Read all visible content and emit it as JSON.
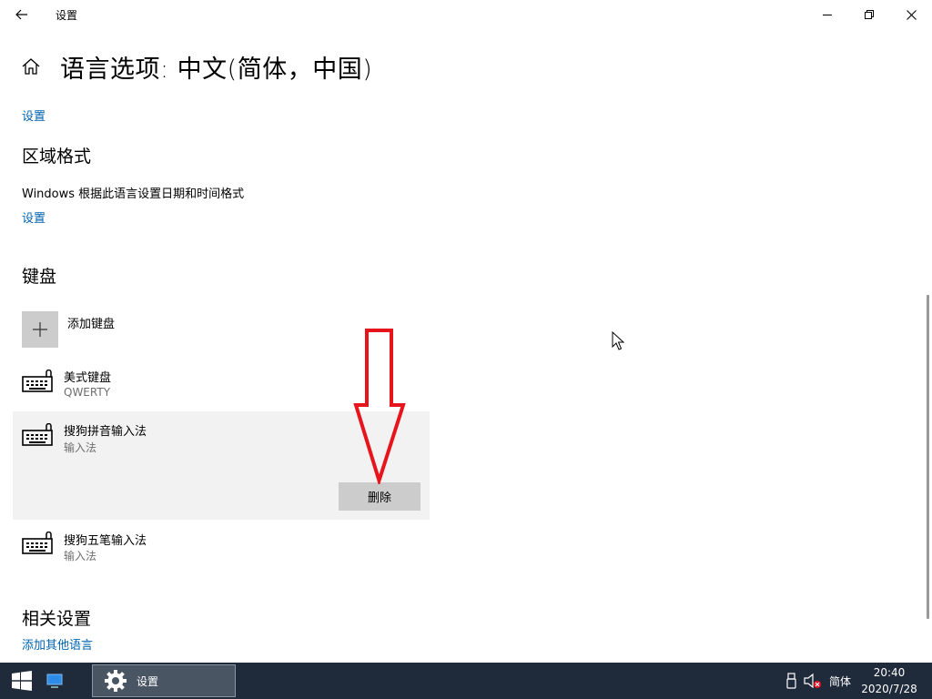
{
  "window": {
    "app_title": "设置",
    "controls": {
      "back": "back-arrow-icon",
      "minimize": "minimize-icon",
      "maximize": "restore-icon",
      "close": "close-icon"
    }
  },
  "header": {
    "title": "语言选项: 中文(简体，中国)",
    "home_icon": "home-icon"
  },
  "top_settings_link": "设置",
  "region": {
    "heading": "区域格式",
    "description": "Windows 根据此语言设置日期和时间格式",
    "settings_link": "设置"
  },
  "keyboard": {
    "heading": "键盘",
    "add_label": "添加键盘",
    "items": [
      {
        "name": "美式键盘",
        "subtitle": "QWERTY"
      },
      {
        "name": "搜狗拼音输入法",
        "subtitle": "输入法",
        "selected": true,
        "action": "删除"
      },
      {
        "name": "搜狗五笔输入法",
        "subtitle": "输入法"
      }
    ]
  },
  "related": {
    "heading": "相关设置",
    "link": "添加其他语言"
  },
  "annotation": {
    "color": "#e8141c",
    "shape": "down-arrow"
  },
  "taskbar": {
    "settings_label": "设置",
    "ime": "简体",
    "time": "20:40",
    "date": "2020/7/28"
  },
  "colors": {
    "accent_link": "#0063b1",
    "taskbar_bg": "#1f2a3a",
    "selected_item_bg": "#f2f2f2",
    "button_bg": "#cccccc"
  }
}
